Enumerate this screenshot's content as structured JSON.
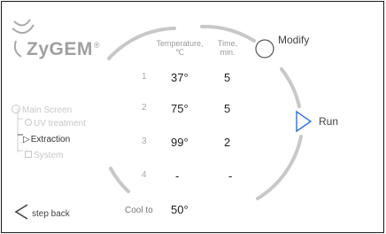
{
  "brand": {
    "name": "ZyGEM",
    "reg": "®"
  },
  "nav": {
    "items": [
      {
        "label": "Main Screen",
        "state": "inactive"
      },
      {
        "label": "UV treatment",
        "state": "inactive"
      },
      {
        "label": "Extraction",
        "state": "active"
      },
      {
        "label": "System",
        "state": "inactive"
      }
    ]
  },
  "table": {
    "headers": {
      "temp_line1": "Temperature,",
      "temp_line2": "℃",
      "time_line1": "Time,",
      "time_line2": "min."
    },
    "rows": [
      {
        "n": "1",
        "temp": "37°",
        "time": "5"
      },
      {
        "n": "2",
        "temp": "75°",
        "time": "5"
      },
      {
        "n": "3",
        "temp": "99°",
        "time": "2"
      },
      {
        "n": "4",
        "temp": "-",
        "time": "-"
      }
    ],
    "cool": {
      "label": "Cool to",
      "temp": "50°"
    }
  },
  "buttons": {
    "modify": "Modify",
    "run": "Run",
    "back": "step back"
  },
  "colors": {
    "arc": "#c4c4c4",
    "accent": "#2f6fd6",
    "text": "#222222",
    "muted": "#a0a0a0"
  }
}
